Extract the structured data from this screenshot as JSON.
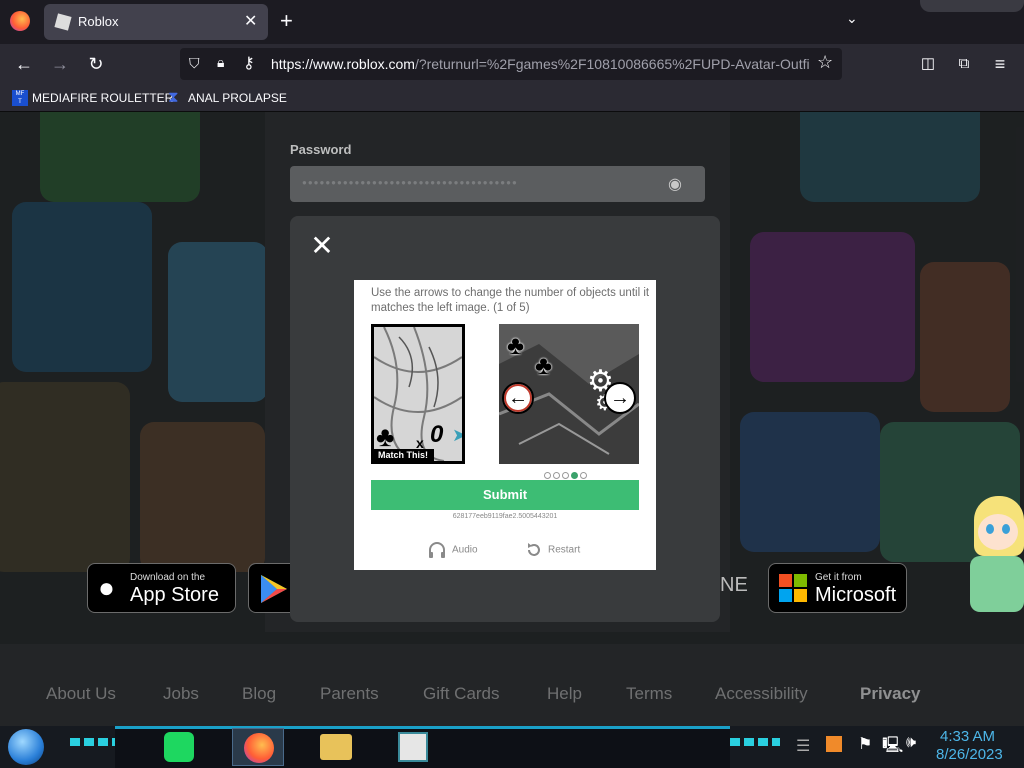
{
  "browser": {
    "tab_title": "Roblox",
    "url_host": "https://www.roblox.com",
    "url_rest": "/?returnurl=%2Fgames%2F10810086665%2FUPD-Avatar-Outfi",
    "bookmarks": [
      {
        "label": "MEDIAFIRE ROULETTER",
        "icon": "mediafire-icon"
      },
      {
        "label": "ANAL PROLAPSE",
        "icon": "bookmark-icon"
      }
    ]
  },
  "login": {
    "password_label": "Password",
    "password_mask": "●●●●●●●●●●●●●●●●●●●●●●●●●●●●●●●●●●●●●"
  },
  "captcha": {
    "instruction": "Use the arrows to change the number of objects until it matches the left image. (1 of 5)",
    "match_label": "Match This!",
    "left_count_text": "x",
    "submit_label": "Submit",
    "session_id": "628177eeb9119fae2.5005443201",
    "audio_label": "Audio",
    "restart_label": "Restart",
    "progress": {
      "current": 4,
      "total": 5
    }
  },
  "stores": {
    "apple_small": "Download on the",
    "apple_big": "App Store",
    "ms_small": "Get it from",
    "ms_big": "Microsoft",
    "partial_text": "NE"
  },
  "footer": {
    "links": [
      "About Us",
      "Jobs",
      "Blog",
      "Parents",
      "Gift Cards",
      "Help",
      "Terms",
      "Accessibility",
      "Privacy"
    ]
  },
  "taskbar": {
    "time": "4:33 AM",
    "date": "8/26/2023"
  },
  "colors": {
    "submit": "#3dbd74",
    "clock": "#4db6e8",
    "progress_active": "#3ba26b"
  }
}
